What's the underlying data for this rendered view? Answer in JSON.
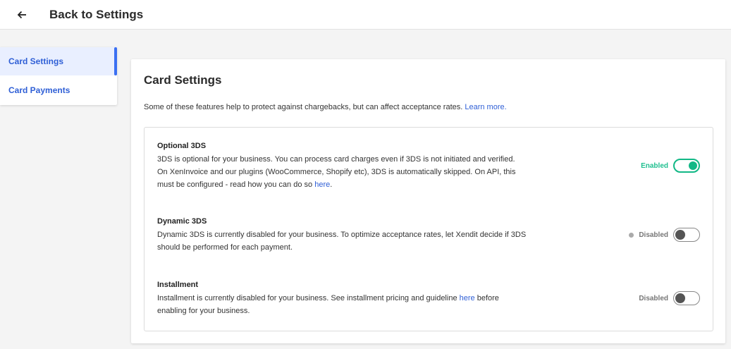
{
  "header": {
    "back_label": "Back to Settings",
    "back_icon": "arrow-left-icon"
  },
  "sidebar": {
    "items": [
      {
        "label": "Card Settings",
        "active": true
      },
      {
        "label": "Card Payments",
        "active": false
      }
    ]
  },
  "main": {
    "title": "Card Settings",
    "subtitle": "Some of these features help to protect against chargebacks, but can affect acceptance rates.",
    "subtitle_link": "Learn more.",
    "features": [
      {
        "title": "Optional 3DS",
        "desc_line1": "3DS is optional for your business. You can process card charges even if 3DS is not initiated and verified.",
        "desc_line2": "On XenInvoice and our plugins (WooCommerce, Shopify etc), 3DS is automatically skipped. On API, this",
        "desc_line3": "must be configured - read how you can do so",
        "desc_link": "here",
        "desc_end": ".",
        "status": "Enabled",
        "enabled": true
      },
      {
        "title": "Dynamic 3DS",
        "desc_line1": "Dynamic 3DS is currently disabled for your business. To optimize acceptance rates, let Xendit decide if 3DS",
        "desc_line2": "should be performed for each payment.",
        "status": "Disabled",
        "enabled": false
      },
      {
        "title": "Installment",
        "desc_line1": "Installment is currently disabled for your business. See installment pricing and guideline",
        "desc_link": "here",
        "desc_line1_end": "before",
        "desc_line2": "enabling for your business.",
        "status": "Disabled",
        "enabled": false
      }
    ]
  },
  "colors": {
    "accent_blue": "#2f5fd6",
    "enabled_green": "#12b886",
    "background": "#f4f4f4"
  }
}
